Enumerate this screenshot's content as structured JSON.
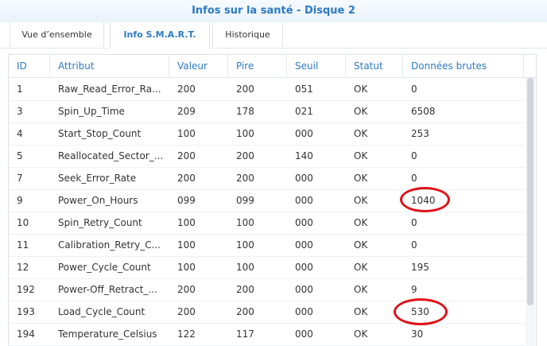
{
  "window": {
    "title": "Infos sur la santé - Disque 2"
  },
  "tabs": [
    {
      "label": "Vue d’ensemble",
      "active": false
    },
    {
      "label": "Info S.M.A.R.T.",
      "active": true
    },
    {
      "label": "Historique",
      "active": false
    }
  ],
  "table": {
    "columns": [
      "ID",
      "Attribut",
      "Valeur",
      "Pire",
      "Seuil",
      "Statut",
      "Données brutes"
    ],
    "rows": [
      [
        "1",
        "Raw_Read_Error_Ra...",
        "200",
        "200",
        "051",
        "OK",
        "0"
      ],
      [
        "3",
        "Spin_Up_Time",
        "209",
        "178",
        "021",
        "OK",
        "6508"
      ],
      [
        "4",
        "Start_Stop_Count",
        "100",
        "100",
        "000",
        "OK",
        "253"
      ],
      [
        "5",
        "Reallocated_Sector_...",
        "200",
        "200",
        "140",
        "OK",
        "0"
      ],
      [
        "7",
        "Seek_Error_Rate",
        "200",
        "200",
        "000",
        "OK",
        "0"
      ],
      [
        "9",
        "Power_On_Hours",
        "099",
        "099",
        "000",
        "OK",
        "1040"
      ],
      [
        "10",
        "Spin_Retry_Count",
        "100",
        "100",
        "000",
        "OK",
        "0"
      ],
      [
        "11",
        "Calibration_Retry_C...",
        "100",
        "100",
        "000",
        "OK",
        "0"
      ],
      [
        "12",
        "Power_Cycle_Count",
        "100",
        "100",
        "000",
        "OK",
        "195"
      ],
      [
        "192",
        "Power-Off_Retract_...",
        "200",
        "200",
        "000",
        "OK",
        "9"
      ],
      [
        "193",
        "Load_Cycle_Count",
        "200",
        "200",
        "000",
        "OK",
        "530"
      ],
      [
        "194",
        "Temperature_Celsius",
        "122",
        "117",
        "000",
        "OK",
        "30"
      ]
    ]
  },
  "highlights": {
    "color": "#e01018",
    "rows": [
      5,
      10
    ]
  }
}
